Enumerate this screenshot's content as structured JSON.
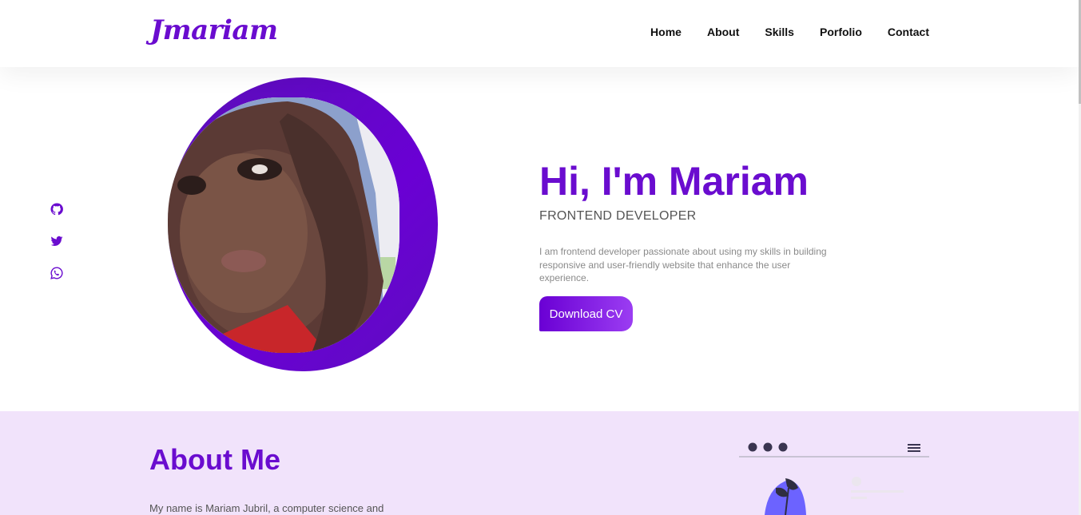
{
  "header": {
    "logo": "Jmariam",
    "nav": [
      "Home",
      "About",
      "Skills",
      "Porfolio",
      "Contact"
    ]
  },
  "social": {
    "icons": [
      "github-icon",
      "twitter-icon",
      "whatsapp-icon"
    ]
  },
  "hero": {
    "title": "Hi, I'm Mariam",
    "subtitle": "FRONTEND DEVELOPER",
    "description": "I am frontend developer passionate about using my skills in building responsive and user-friendly website that enhance the user experience.",
    "cta": "Download CV"
  },
  "about": {
    "title": "About Me",
    "text": "My name is Mariam Jubril, a computer science and"
  },
  "colors": {
    "accent": "#6a0ccf",
    "about_bg": "#f1e3fb",
    "button_end": "#9b3df2"
  }
}
